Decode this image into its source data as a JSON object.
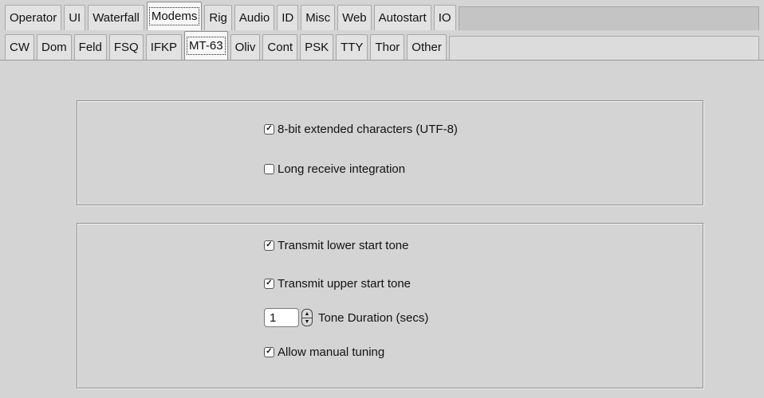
{
  "tabs_main": [
    "Operator",
    "UI",
    "Waterfall",
    "Modems",
    "Rig",
    "Audio",
    "ID",
    "Misc",
    "Web",
    "Autostart",
    "IO"
  ],
  "tabs_main_selected": "Modems",
  "tabs_modems": [
    "CW",
    "Dom",
    "Feld",
    "FSQ",
    "IFKP",
    "MT-63",
    "Oliv",
    "Cont",
    "PSK",
    "TTY",
    "Thor",
    "Other"
  ],
  "tabs_modems_selected": "MT-63",
  "group1": {
    "utf8_label": "8-bit extended characters (UTF-8)",
    "utf8_checked": true,
    "long_integration_label": "Long receive integration",
    "long_integration_checked": false
  },
  "group2": {
    "lower_tone_label": "Transmit lower start tone",
    "lower_tone_checked": true,
    "upper_tone_label": "Transmit upper start tone",
    "upper_tone_checked": true,
    "tone_duration_value": "1",
    "tone_duration_label": "Tone Duration (secs)",
    "manual_tuning_label": "Allow manual tuning",
    "manual_tuning_checked": true
  },
  "check_glyph": "✓"
}
